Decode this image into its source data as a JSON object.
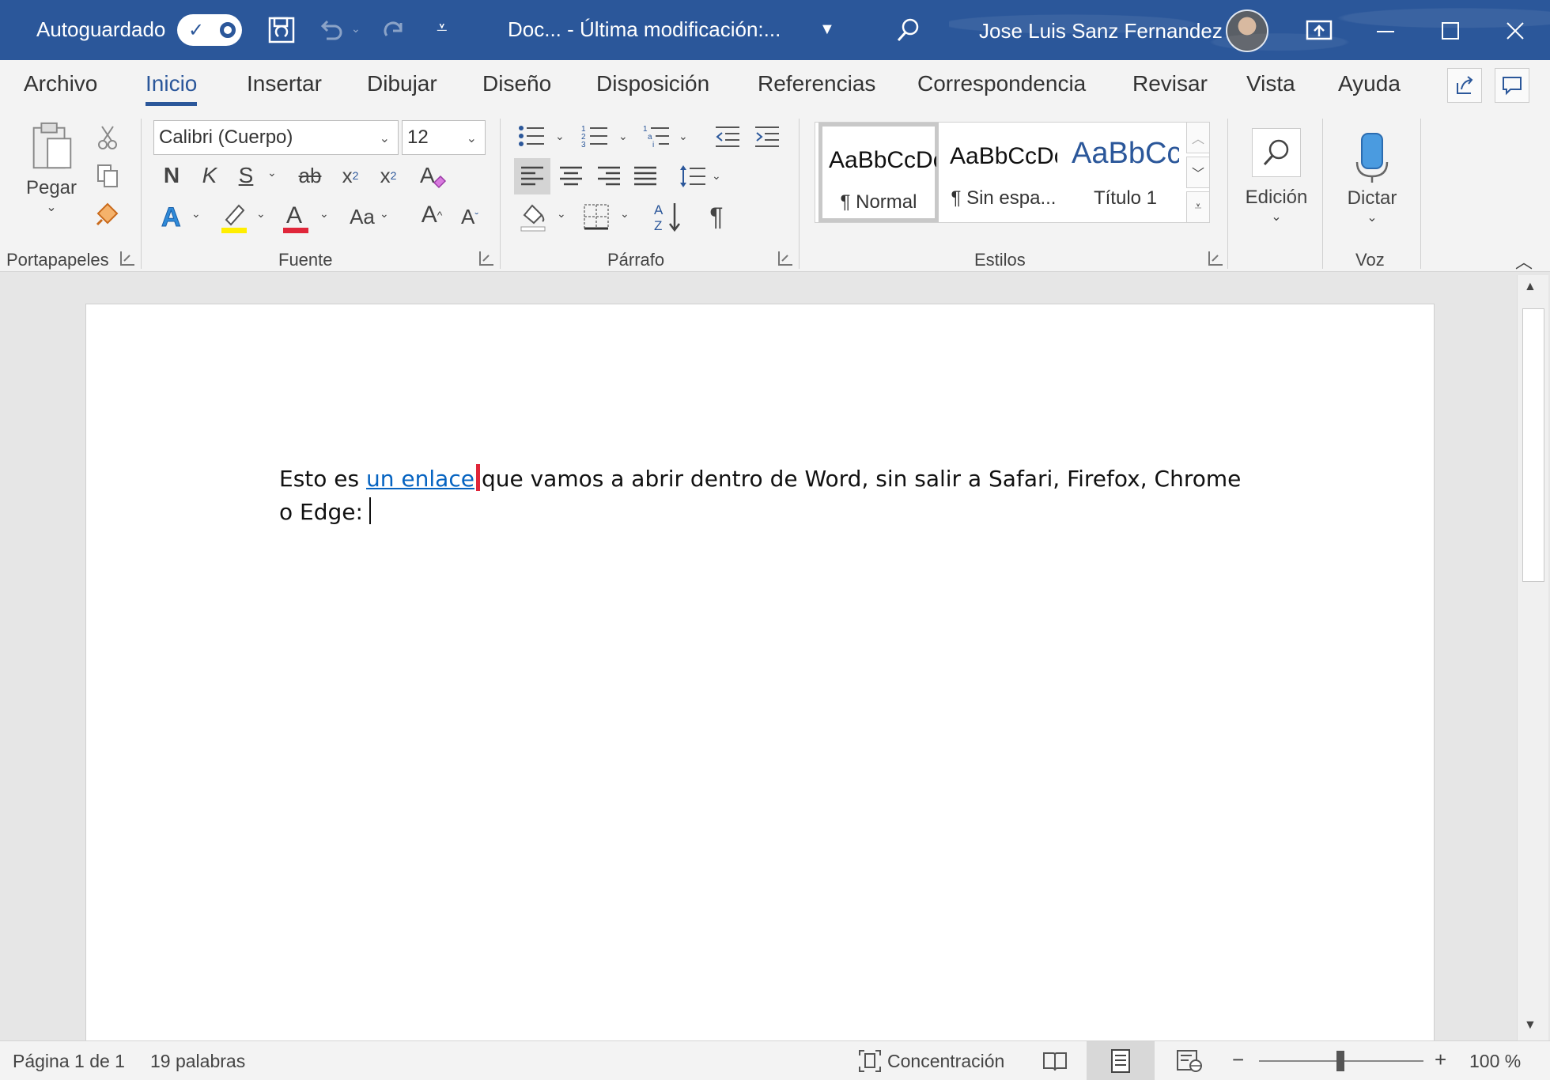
{
  "titlebar": {
    "autosave_label": "Autoguardado",
    "doc_title": "Doc...  - Última modificación:...",
    "user_name": "Jose Luis Sanz Fernandez"
  },
  "menu": {
    "tabs": [
      "Archivo",
      "Inicio",
      "Insertar",
      "Dibujar",
      "Diseño",
      "Disposición",
      "Referencias",
      "Correspondencia",
      "Revisar",
      "Vista",
      "Ayuda"
    ],
    "active": "Inicio"
  },
  "ribbon": {
    "clipboard": {
      "paste_label": "Pegar",
      "group_label": "Portapapeles"
    },
    "font": {
      "font_name": "Calibri (Cuerpo)",
      "font_size": "12",
      "bold": "N",
      "italic": "K",
      "underline": "S",
      "strike": "ab",
      "subscript": "x",
      "superscript": "x",
      "case": "Aa",
      "grow": "A",
      "shrink": "A",
      "group_label": "Fuente"
    },
    "paragraph": {
      "group_label": "Párrafo"
    },
    "styles": {
      "items": [
        {
          "sample": "AaBbCcDc",
          "name": "¶ Normal"
        },
        {
          "sample": "AaBbCcDc",
          "name": "¶ Sin espa..."
        },
        {
          "sample": "AaBbCc",
          "name": "Título 1"
        }
      ],
      "group_label": "Estilos"
    },
    "editing": {
      "label": "Edición"
    },
    "voice": {
      "label": "Dictar",
      "group_label": "Voz"
    }
  },
  "document": {
    "text_before": "Esto es ",
    "link_text": "un enlace",
    "text_after": "que vamos a abrir dentro de Word, sin salir a Safari, Firefox, Chrome o Edge:"
  },
  "statusbar": {
    "page": "Página 1 de 1",
    "words": "19 palabras",
    "focus": "Concentración",
    "zoom_minus": "−",
    "zoom_plus": "+",
    "zoom": "100 %"
  },
  "colors": {
    "accent": "#2b579a",
    "link": "#0563c1",
    "highlight": "#ffee00",
    "font_color": "#e0263a"
  }
}
